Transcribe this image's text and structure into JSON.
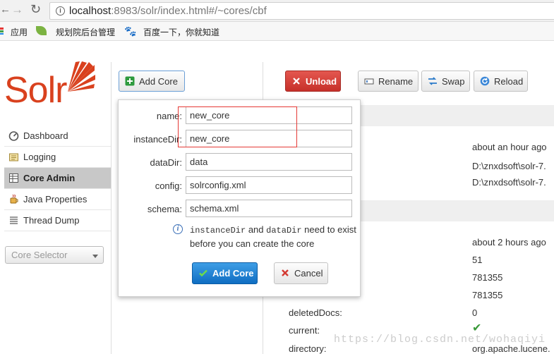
{
  "browser": {
    "url_host": "localhost",
    "url_rest": ":8983/solr/index.html#/~cores/cbf",
    "bookmarks": [
      {
        "label": "应用"
      },
      {
        "label": "规划院后台管理"
      },
      {
        "label": "百度一下，你就知道"
      }
    ]
  },
  "logo": {
    "text": "Solr"
  },
  "sidebar": {
    "items": [
      {
        "label": "Dashboard",
        "icon": "dashboard-icon"
      },
      {
        "label": "Logging",
        "icon": "logging-icon"
      },
      {
        "label": "Core Admin",
        "icon": "core-admin-icon",
        "active": true
      },
      {
        "label": "Java Properties",
        "icon": "java-icon"
      },
      {
        "label": "Thread Dump",
        "icon": "thread-dump-icon"
      }
    ],
    "core_selector": "Core Selector"
  },
  "toolbar": {
    "add_core": "Add Core",
    "unload": "Unload",
    "rename": "Rename",
    "swap": "Swap",
    "reload": "Reload"
  },
  "core_info": {
    "start_time": "about an hour ago",
    "instance_dir": "D:\\znxdsoft\\solr-7.",
    "data_dir": "D:\\znxdsoft\\solr-7.",
    "last_modified": "about 2 hours ago",
    "version": "51",
    "num_docs": "781355",
    "max_doc": "781355",
    "deleted_docs_label": "deletedDocs:",
    "deleted_docs": "0",
    "current_label": "current:",
    "directory_label": "directory:",
    "directory": "org.apache.lucene."
  },
  "dialog": {
    "fields": {
      "name": {
        "label": "name:",
        "value": "new_core"
      },
      "instance_dir": {
        "label": "instanceDir:",
        "value": "new_core"
      },
      "data_dir": {
        "label": "dataDir:",
        "value": "data"
      },
      "config": {
        "label": "config:",
        "value": "solrconfig.xml"
      },
      "schema": {
        "label": "schema:",
        "value": "schema.xml"
      }
    },
    "hint": {
      "code1": "instanceDir",
      "and": " and ",
      "code2": "dataDir",
      "rest1": " need to exist",
      "line2": "before you can create the core"
    },
    "submit": "Add Core",
    "cancel": "Cancel"
  },
  "watermark": "https://blog.csdn.net/wohaqiyi",
  "colors": {
    "solr_orange": "#d9411e",
    "unload_red": "#d33a33",
    "primary_blue": "#1a7fd4",
    "highlight_red": "#e53935"
  }
}
